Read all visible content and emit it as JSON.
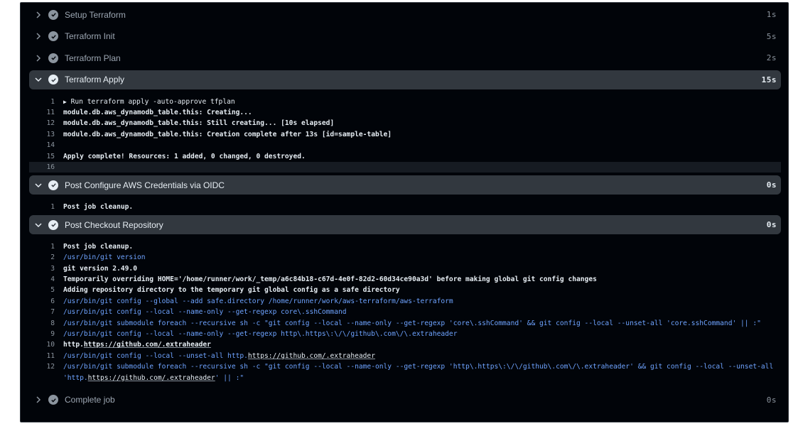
{
  "steps": [
    {
      "title": "Setup Terraform",
      "duration": "1s",
      "expanded": false
    },
    {
      "title": "Terraform Init",
      "duration": "5s",
      "expanded": false
    },
    {
      "title": "Terraform Plan",
      "duration": "2s",
      "expanded": false
    },
    {
      "title": "Terraform Apply",
      "duration": "15s",
      "expanded": true
    },
    {
      "title": "Post Configure AWS Credentials via OIDC",
      "duration": "0s",
      "expanded": true
    },
    {
      "title": "Post Checkout Repository",
      "duration": "0s",
      "expanded": true
    },
    {
      "title": "Complete job",
      "duration": "0s",
      "expanded": false
    }
  ],
  "apply_log": [
    {
      "n": "1",
      "text": "Run terraform apply -auto-approve tfplan",
      "group": "▶"
    },
    {
      "n": "11",
      "text": "module.db.aws_dynamodb_table.this: Creating..."
    },
    {
      "n": "12",
      "text": "module.db.aws_dynamodb_table.this: Still creating... [10s elapsed]"
    },
    {
      "n": "13",
      "text": "module.db.aws_dynamodb_table.this: Creation complete after 13s [id=sample-table]"
    },
    {
      "n": "14",
      "text": ""
    },
    {
      "n": "15",
      "text": "Apply complete! Resources: 1 added, 0 changed, 0 destroyed."
    },
    {
      "n": "16",
      "text": ""
    }
  ],
  "oidc_log": [
    {
      "n": "1",
      "text": "Post job cleanup."
    }
  ],
  "checkout_log": [
    {
      "n": "1",
      "text": "Post job cleanup."
    },
    {
      "n": "2",
      "text": "/usr/bin/git version"
    },
    {
      "n": "3",
      "text": "git version 2.49.0"
    },
    {
      "n": "4",
      "text": "Temporarily overriding HOME='/home/runner/work/_temp/a6c84b18-c67d-4e0f-82d2-60d34ce90a3d' before making global git config changes"
    },
    {
      "n": "5",
      "text": "Adding repository directory to the temporary git global config as a safe directory"
    },
    {
      "n": "6",
      "text": "/usr/bin/git config --global --add safe.directory /home/runner/work/aws-terraform/aws-terraform"
    },
    {
      "n": "7",
      "text": "/usr/bin/git config --local --name-only --get-regexp core\\.sshCommand"
    },
    {
      "n": "8",
      "text": "/usr/bin/git submodule foreach --recursive sh -c \"git config --local --name-only --get-regexp 'core\\.sshCommand' && git config --local --unset-all 'core.sshCommand' || :\""
    },
    {
      "n": "9",
      "text": "/usr/bin/git config --local --name-only --get-regexp http\\.https\\:\\/\\/github\\.com\\/\\.extraheader"
    },
    {
      "n": "10",
      "text_pre": "http.",
      "link": "https://github.com/.extraheader"
    },
    {
      "n": "11",
      "text_pre": "/usr/bin/git config --local --unset-all http.",
      "link": "https://github.com/.extraheader"
    },
    {
      "n": "12",
      "text": "/usr/bin/git submodule foreach --recursive sh -c \"git config --local --name-only --get-regexp 'http\\.https\\:\\/\\/github\\.com\\/\\.extraheader' && git config --local --unset-all"
    },
    {
      "n": "",
      "text_pre": "'http.",
      "link": "https://github.com/.extraheader",
      "text_post": "' || :\""
    }
  ]
}
